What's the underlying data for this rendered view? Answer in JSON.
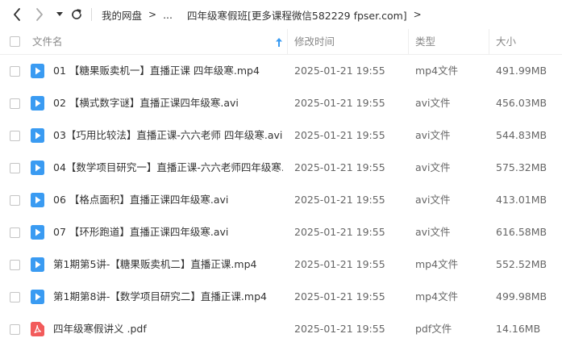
{
  "breadcrumb": {
    "root": "我的网盘",
    "ellipsis": "...",
    "current": "四年级寒假班[更多课程微信582229 fpser.com]"
  },
  "columns": {
    "name": "文件名",
    "modified": "修改时间",
    "type": "类型",
    "size": "大小"
  },
  "files": [
    {
      "name": "01 【糖果贩卖机一】直播正课 四年级寒.mp4",
      "modified": "2025-01-21 19:55",
      "type": "mp4文件",
      "size": "491.99MB",
      "icon": "video-file-icon"
    },
    {
      "name": "02 【横式数字谜】直播正课四年级寒.avi",
      "modified": "2025-01-21 19:55",
      "type": "avi文件",
      "size": "456.03MB",
      "icon": "video-file-icon"
    },
    {
      "name": "03【巧用比较法】直播正课-六六老师 四年级寒.avi",
      "modified": "2025-01-21 19:55",
      "type": "avi文件",
      "size": "544.83MB",
      "icon": "video-file-icon"
    },
    {
      "name": "04【数学项目研究一】直播正课-六六老师四年级寒...",
      "modified": "2025-01-21 19:55",
      "type": "avi文件",
      "size": "575.32MB",
      "icon": "video-file-icon"
    },
    {
      "name": "06 【格点面积】直播正课四年级寒.avi",
      "modified": "2025-01-21 19:55",
      "type": "avi文件",
      "size": "413.01MB",
      "icon": "video-file-icon"
    },
    {
      "name": "07 【环形跑道】直播正课四年级寒.avi",
      "modified": "2025-01-21 19:55",
      "type": "avi文件",
      "size": "616.58MB",
      "icon": "video-file-icon"
    },
    {
      "name": "第1期第5讲-【糖果贩卖机二】直播正课.mp4",
      "modified": "2025-01-21 19:55",
      "type": "mp4文件",
      "size": "552.52MB",
      "icon": "video-file-icon"
    },
    {
      "name": "第1期第8讲-【数学项目研究二】直播正课.mp4",
      "modified": "2025-01-21 19:55",
      "type": "mp4文件",
      "size": "499.98MB",
      "icon": "video-file-icon"
    },
    {
      "name": "四年级寒假讲义 .pdf",
      "modified": "2025-01-21 19:55",
      "type": "pdf文件",
      "size": "14.16MB",
      "icon": "pdf-file-icon"
    }
  ],
  "colors": {
    "video_icon": "#3a9bf2",
    "pdf_icon": "#f25b5b",
    "sort_arrow": "#3a9bf2"
  }
}
